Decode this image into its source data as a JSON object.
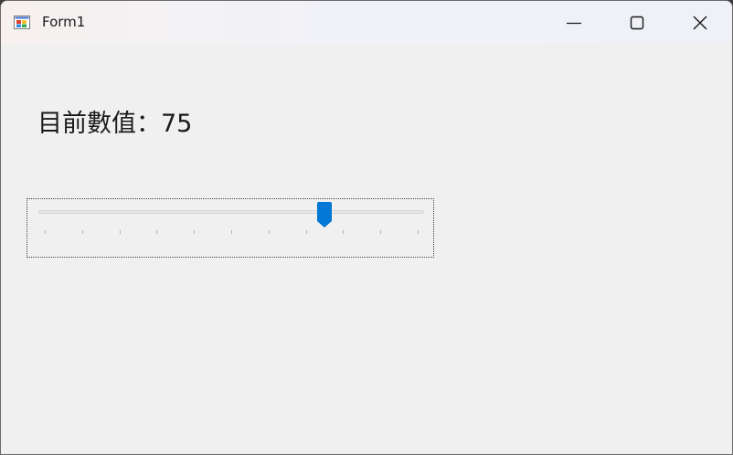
{
  "window": {
    "title": "Form1",
    "app_icon": "winforms-app-icon",
    "controls": {
      "minimize_icon": "minimize-icon",
      "maximize_icon": "maximize-icon",
      "close_icon": "close-icon"
    }
  },
  "form": {
    "value_label": "目前數值：75",
    "trackbar": {
      "value": 75,
      "min": 0,
      "max": 100,
      "tick_frequency": 10,
      "accent_color": "#0078d4"
    }
  }
}
